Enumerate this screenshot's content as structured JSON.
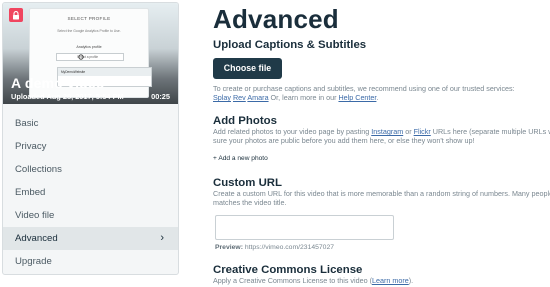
{
  "video": {
    "title": "A demo video",
    "uploaded": "Uploaded Aug 28, 2017, 5:54 PM",
    "duration": "00:25",
    "thumbnail": {
      "heading": "SELECT PROFILE",
      "subtext": "Select the Google Analytics Profile to Use.",
      "field_label": "Analytics profile",
      "select_value": "Select a profile",
      "options": [
        "MyDemoWebsite",
        ""
      ]
    }
  },
  "sidebar": {
    "items": [
      {
        "label": "Basic"
      },
      {
        "label": "Privacy"
      },
      {
        "label": "Collections"
      },
      {
        "label": "Embed"
      },
      {
        "label": "Video file"
      },
      {
        "label": "Advanced",
        "chevron": "›"
      },
      {
        "label": "Upgrade"
      }
    ]
  },
  "main": {
    "title": "Advanced",
    "captions": {
      "heading": "Upload Captions & Subtitles",
      "button": "Choose file",
      "text_before": "To create or purchase captions and subtitles, we recommend using one of our trusted services:",
      "link1": "Splay",
      "link2": "Rev",
      "link3": "Amara",
      "text_after": " Or, learn more in our ",
      "link4": "Help Center",
      "period": "."
    },
    "photos": {
      "heading": "Add Photos",
      "text_a": "Add related photos to your video page by pasting ",
      "link_instagram": "Instagram",
      "text_b": " or ",
      "link_flickr": "Flickr",
      "text_c": " URLs here (separate multiple URLs wit",
      "line2": "sure your photos are public before you add them here, or else they won't show up!",
      "add_link": "+ Add a new photo"
    },
    "custom_url": {
      "heading": "Custom URL",
      "line1": "Create a custom URL for this video that is more memorable than a random string of numbers. Many people c",
      "line2": "matches the video title.",
      "input_value": "",
      "preview_label": "Preview:",
      "preview_value": " https://vimeo.com/231457027"
    },
    "license": {
      "heading": "Creative Commons License",
      "text": "Apply a Creative Commons License to this video (",
      "link": "Learn more",
      "close": ")."
    }
  },
  "colors": {
    "brand_dark": "#1a2e3b",
    "button_bg": "#203a48",
    "link": "#3b6aa7",
    "lock_badge": "#f0455f"
  }
}
